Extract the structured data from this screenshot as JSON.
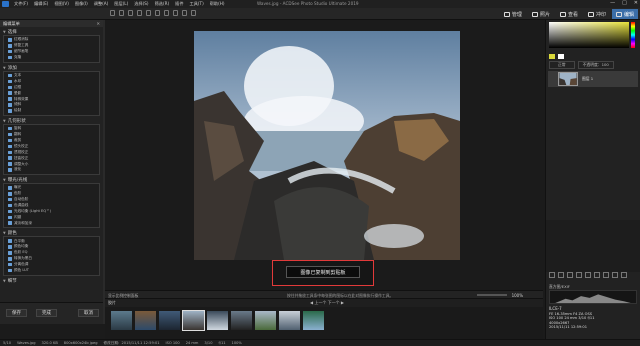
{
  "app": {
    "window_title": "Waves.jpg - ACDSee Photo Studio Ultimate 2019",
    "menu": [
      "文件(F)",
      "编辑(E)",
      "视图(V)",
      "图像(I)",
      "调整(A)",
      "图层(L)",
      "选择(S)",
      "筛选(R)",
      "插件",
      "工具(T)",
      "帮助(H)"
    ],
    "window_buttons": [
      "—",
      "□",
      "✕"
    ]
  },
  "modes": [
    {
      "label": "管理",
      "icon": "grid-icon",
      "active": false
    },
    {
      "label": "照片",
      "icon": "photo-icon",
      "active": false
    },
    {
      "label": "查看",
      "icon": "eye-icon",
      "active": false
    },
    {
      "label": "冲印",
      "icon": "develop-icon",
      "active": false
    },
    {
      "label": "编辑",
      "icon": "edit-icon",
      "active": true
    }
  ],
  "left_panel": {
    "title": "编辑菜单",
    "sections": [
      {
        "title": "选择",
        "items": [
          "红眼消除",
          "修复工具",
          "细节画笔",
          "克隆"
        ]
      },
      {
        "title": "添加",
        "items": [
          "文本",
          "水印",
          "边框",
          "晕影",
          "特殊效果",
          "倾斜",
          "绘制"
        ]
      },
      {
        "title": "几何形状",
        "items": [
          "旋转",
          "翻转",
          "裁剪",
          "镜头校正",
          "透视校正",
          "扭曲校正",
          "调整大小",
          "液化"
        ]
      },
      {
        "title": "曝光/光线",
        "items": [
          "曝光",
          "色阶",
          "自动色阶",
          "色调曲线",
          "光线均衡 (Light EQ™)",
          "闪避",
          "减淡和加深"
        ]
      },
      {
        "title": "颜色",
        "items": [
          "白平衡",
          "颜色均衡",
          "色彩 EQ",
          "转换为黑白",
          "分离色调",
          "颜色 LUT"
        ]
      },
      {
        "title": "细节",
        "items": []
      }
    ],
    "footer": {
      "save": "保存",
      "done": "完成",
      "cancel": "取消"
    }
  },
  "canvas": {
    "toast": "图像已复制到剪贴板",
    "status_left": "显示比例控制面板",
    "status_center": "按住并拖放工具条中每张图的图标以在此对图像执行操作工具。",
    "zoom": "100%"
  },
  "filmstrip": {
    "title": "胶片",
    "nav_prev": "◀ 上一个",
    "nav_next": "下一个 ▶",
    "thumb_count": 9,
    "selected_index": 3
  },
  "right_panel": {
    "title": "颜色图像",
    "blend_label": "正常",
    "opacity_label": "不透明度：100",
    "layer_name": "图层 1",
    "section_title": "图层",
    "info_title": "直方图/EXIF",
    "exif": {
      "camera": "ILCE-7",
      "lens": "FE 16-35mm F4 ZA OSS",
      "iso": "ISO 100",
      "focal": "24 mm",
      "shutter": "3/10",
      "fstop": "f/11",
      "resolution": "4000x2667",
      "date": "2015/11/11 12:59:01"
    }
  },
  "bottom_status": {
    "items": [
      "5/10",
      "Waves.jpg",
      "320.0 KB",
      "800x600x24b jpeg",
      "修改日期：2015/11/11 12:59:01",
      "ISO 100",
      "24 mm",
      "3/10",
      "f/11",
      "100%"
    ]
  }
}
